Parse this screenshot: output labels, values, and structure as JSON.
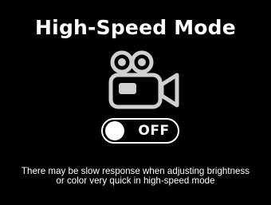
{
  "screen": {
    "title": "High-Speed Mode",
    "icon": "video-camera-icon",
    "toggle": {
      "label": "OFF",
      "state": "off"
    },
    "note_lines": [
      "There may be slow response when adjusting brightness",
      "or color very quick in high-speed mode"
    ]
  },
  "colors": {
    "background": "#000000",
    "foreground": "#ffffff",
    "icon": "#d0d0d0"
  }
}
